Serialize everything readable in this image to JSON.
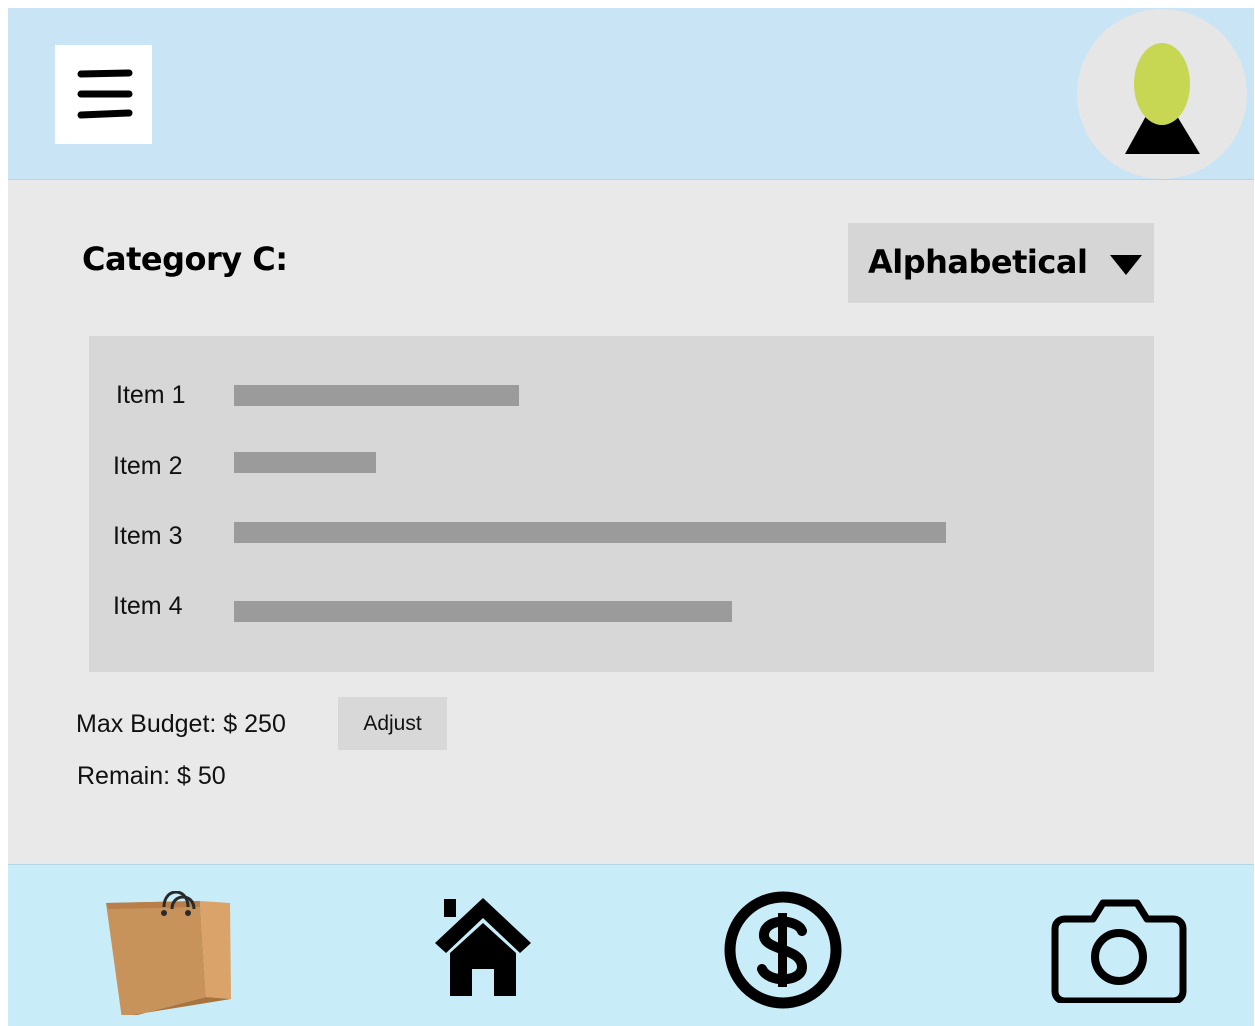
{
  "header": {
    "menu_icon": "hamburger-menu-icon",
    "avatar_icon": "user-avatar-icon",
    "avatar_colors": {
      "head": "#c8d753",
      "body": "#000000",
      "background": "#e6e6e6"
    }
  },
  "category": {
    "title": "Category C:"
  },
  "sort": {
    "selected": "Alphabetical",
    "icon": "caret-down-icon"
  },
  "items": [
    {
      "label": "Item 1",
      "fill": 0.4
    },
    {
      "label": "Item 2",
      "fill": 0.2
    },
    {
      "label": "Item 3",
      "fill": 1.0
    },
    {
      "label": "Item 4",
      "fill": 0.7
    }
  ],
  "budget": {
    "max_label": "Max Budget: $ 250",
    "remain_label": "Remain: $ 50",
    "adjust_label": "Adjust"
  },
  "bottom_nav": [
    {
      "name": "shopping-bag-icon"
    },
    {
      "name": "home-icon"
    },
    {
      "name": "dollar-icon"
    },
    {
      "name": "camera-icon"
    }
  ],
  "colors": {
    "header_bg": "#c9e4f5",
    "content_bg": "#e9e9e9",
    "panel_bg": "#d7d7d7",
    "bar": "#9b9b9b",
    "nav_bg": "#c8ecf8"
  }
}
